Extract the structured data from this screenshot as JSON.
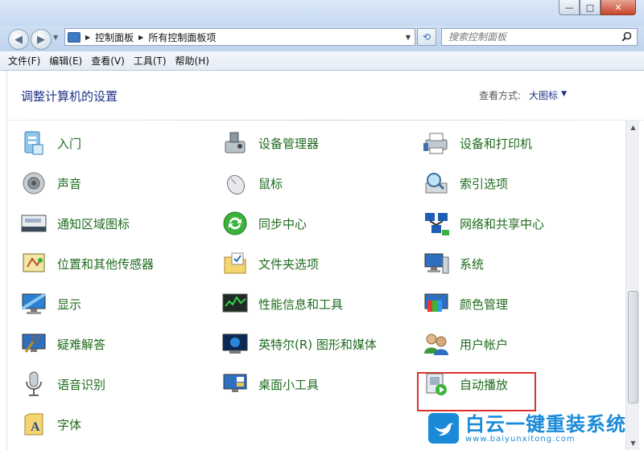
{
  "window": {
    "minimize": "—",
    "maximize": "□",
    "close": "✕"
  },
  "address": {
    "breadcrumbs": [
      "控制面板",
      "所有控制面板项"
    ],
    "search_placeholder": "搜索控制面板"
  },
  "menu": [
    "文件(F)",
    "编辑(E)",
    "查看(V)",
    "工具(T)",
    "帮助(H)"
  ],
  "header": {
    "title": "调整计算机的设置",
    "view_by_label": "查看方式:",
    "view_by_value": "大图标"
  },
  "items": [
    {
      "label": "入门",
      "icon": "getting-started-icon"
    },
    {
      "label": "设备管理器",
      "icon": "device-manager-icon"
    },
    {
      "label": "设备和打印机",
      "icon": "devices-printers-icon"
    },
    {
      "label": "声音",
      "icon": "sound-icon"
    },
    {
      "label": "鼠标",
      "icon": "mouse-icon"
    },
    {
      "label": "索引选项",
      "icon": "indexing-icon"
    },
    {
      "label": "通知区域图标",
      "icon": "notification-area-icon"
    },
    {
      "label": "同步中心",
      "icon": "sync-center-icon"
    },
    {
      "label": "网络和共享中心",
      "icon": "network-sharing-icon"
    },
    {
      "label": "位置和其他传感器",
      "icon": "location-sensors-icon"
    },
    {
      "label": "文件夹选项",
      "icon": "folder-options-icon"
    },
    {
      "label": "系统",
      "icon": "system-icon"
    },
    {
      "label": "显示",
      "icon": "display-icon"
    },
    {
      "label": "性能信息和工具",
      "icon": "performance-icon"
    },
    {
      "label": "颜色管理",
      "icon": "color-management-icon"
    },
    {
      "label": "疑难解答",
      "icon": "troubleshooting-icon"
    },
    {
      "label": "英特尔(R) 图形和媒体",
      "icon": "intel-graphics-icon"
    },
    {
      "label": "用户帐户",
      "icon": "user-accounts-icon"
    },
    {
      "label": "语音识别",
      "icon": "speech-recognition-icon"
    },
    {
      "label": "桌面小工具",
      "icon": "desktop-gadgets-icon"
    },
    {
      "label": "自动播放",
      "icon": "autoplay-icon"
    },
    {
      "label": "字体",
      "icon": "fonts-icon"
    }
  ],
  "highlighted_item": "用户帐户",
  "colors": {
    "link_green": "#1f6b1f",
    "title_blue": "#1e3287",
    "highlight_red": "#e0302b",
    "watermark_blue": "#1a8ad8"
  },
  "watermark": {
    "text": "白云一键重装系统",
    "url": "www.baiyunxitong.com"
  }
}
